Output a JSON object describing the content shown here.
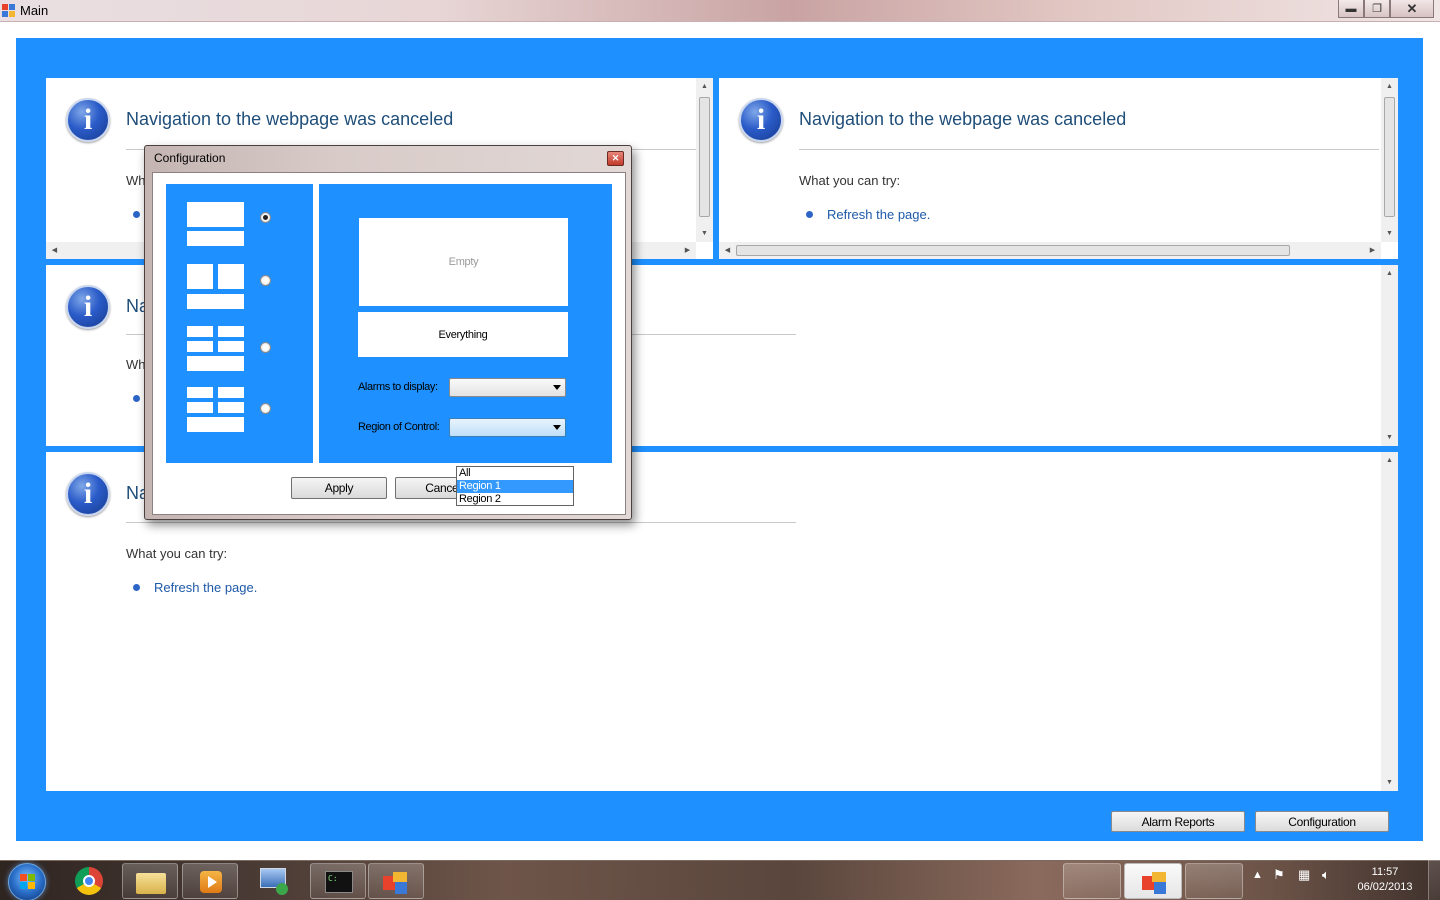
{
  "window": {
    "title": "Main",
    "controls": {
      "minimize": "▬",
      "maximize": "❐",
      "close": "✕"
    }
  },
  "panes": [
    {
      "title": "Navigation to the webpage was canceled",
      "try": "Wh",
      "refresh": ""
    },
    {
      "title": "Navigation to the webpage was canceled",
      "try": "What you can try:",
      "refresh": "Refresh the page."
    },
    {
      "title": "Na",
      "try": "Wh",
      "refresh": ""
    },
    {
      "title": "Na",
      "try": "What you can try:",
      "refresh": "Refresh the page."
    }
  ],
  "bottom_buttons": {
    "alarm_reports": "Alarm Reports",
    "configuration": "Configuration"
  },
  "dialog": {
    "title": "Configuration",
    "close": "✕",
    "layout_options": [
      "layout-1-2-rows",
      "layout-2-top-1-bottom",
      "layout-2-2-1",
      "layout-2-2-1-wide"
    ],
    "selected_layout": 0,
    "preview_empty": "Empty",
    "preview_everything": "Everything",
    "alarms_label": "Alarms to display:",
    "alarms_value": "",
    "region_label": "Region of Control:",
    "region_value": "",
    "region_options": [
      "All",
      "Region 1",
      "Region 2"
    ],
    "region_highlighted": "Region 1",
    "apply": "Apply",
    "cancel": "Cancel"
  },
  "taskbar": {
    "items": [
      "start-button",
      "chrome",
      "file-explorer",
      "media-player",
      "remote-desktop",
      "command-prompt",
      "main-app"
    ],
    "clock_time": "11:57",
    "clock_date": "06/02/2013"
  },
  "colors": {
    "accent_blue": "#1e90ff",
    "link_blue": "#1e5aa8",
    "title_blue": "#1f4e79",
    "highlight": "#3399ff"
  }
}
